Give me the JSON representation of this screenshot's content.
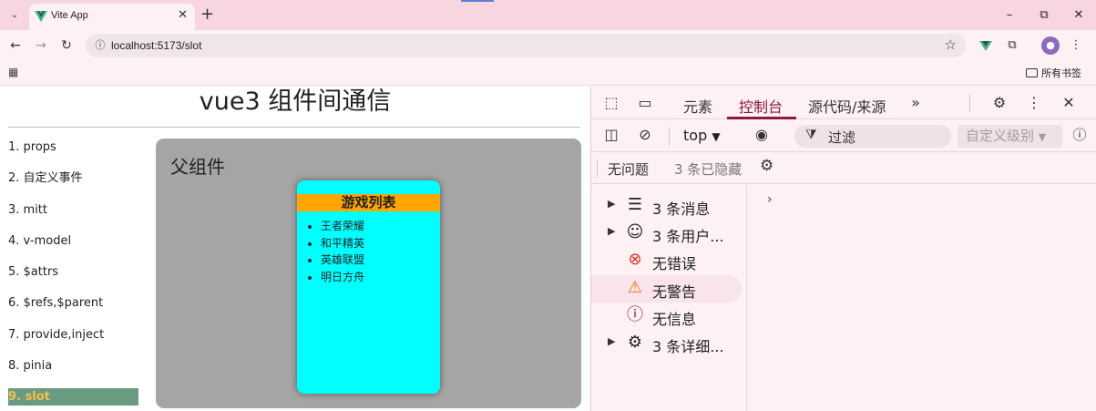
{
  "browser": {
    "tab_title": "Vite App",
    "url": "localhost:5173/slot",
    "bookmarks_folder": "所有书签",
    "accent_color": "#42b883"
  },
  "page": {
    "title": "vue3 组件间通信",
    "nav": [
      {
        "label": "1. props",
        "active": false
      },
      {
        "label": "2. 自定义事件",
        "active": false
      },
      {
        "label": "3. mitt",
        "active": false
      },
      {
        "label": "4. v-model",
        "active": false
      },
      {
        "label": "5. $attrs",
        "active": false
      },
      {
        "label": "6. $refs,$parent",
        "active": false
      },
      {
        "label": "7. provide,inject",
        "active": false
      },
      {
        "label": "8. pinia",
        "active": false
      },
      {
        "label": "9. slot",
        "active": true
      }
    ],
    "parent_title": "父组件",
    "card": {
      "title": "游戏列表",
      "items": [
        "王者荣耀",
        "和平精英",
        "英雄联盟",
        "明日方舟"
      ]
    }
  },
  "devtools": {
    "tabs": [
      {
        "label": "元素",
        "active": false
      },
      {
        "label": "控制台",
        "active": true
      },
      {
        "label": "源代码/来源",
        "active": false
      }
    ],
    "context": "top",
    "filter_placeholder": "过滤",
    "level_label": "自定义级别",
    "issues_label": "无问题",
    "hidden_label": "3 条已隐藏",
    "sidebar": [
      {
        "label": "3 条消息",
        "icon": "list-icon",
        "expandable": true,
        "selected": false
      },
      {
        "label": "3 条用户...",
        "icon": "user-icon",
        "expandable": true,
        "selected": false
      },
      {
        "label": "无错误",
        "icon": "error-icon",
        "expandable": false,
        "selected": false
      },
      {
        "label": "无警告",
        "icon": "warning-icon",
        "expandable": false,
        "selected": true
      },
      {
        "label": "无信息",
        "icon": "info-icon",
        "expandable": false,
        "selected": false
      },
      {
        "label": "3 条详细...",
        "icon": "bug-icon",
        "expandable": true,
        "selected": false
      }
    ]
  }
}
